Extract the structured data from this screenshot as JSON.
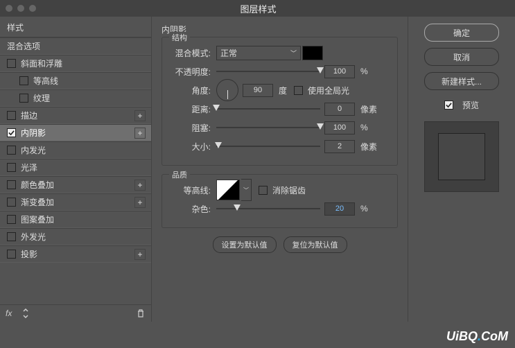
{
  "title": "图层样式",
  "sidebar": {
    "header": "样式",
    "blend": "混合选项",
    "items": [
      {
        "label": "斜面和浮雕"
      },
      {
        "label": "等高线",
        "sub": true
      },
      {
        "label": "纹理",
        "sub": true
      },
      {
        "label": "描边",
        "plus": true
      },
      {
        "label": "内阴影",
        "plus": true,
        "checked": true,
        "selected": true
      },
      {
        "label": "内发光"
      },
      {
        "label": "光泽"
      },
      {
        "label": "颜色叠加",
        "plus": true
      },
      {
        "label": "渐变叠加",
        "plus": true
      },
      {
        "label": "图案叠加"
      },
      {
        "label": "外发光"
      },
      {
        "label": "投影",
        "plus": true
      }
    ]
  },
  "main": {
    "title": "内阴影",
    "structure": {
      "legend": "结构",
      "blend_mode_label": "混合模式:",
      "blend_mode_value": "正常",
      "opacity_label": "不透明度:",
      "opacity_value": "100",
      "opacity_unit": "%",
      "angle_label": "角度:",
      "angle_value": "90",
      "angle_unit": "度",
      "global_light": "使用全局光",
      "distance_label": "距离:",
      "distance_value": "0",
      "distance_unit": "像素",
      "choke_label": "阻塞:",
      "choke_value": "100",
      "choke_unit": "%",
      "size_label": "大小:",
      "size_value": "2",
      "size_unit": "像素"
    },
    "quality": {
      "legend": "品质",
      "contour_label": "等高线:",
      "antialias": "消除锯齿",
      "noise_label": "杂色:",
      "noise_value": "20",
      "noise_unit": "%"
    },
    "set_default": "设置为默认值",
    "reset_default": "复位为默认值"
  },
  "right": {
    "ok": "确定",
    "cancel": "取消",
    "new_style": "新建样式...",
    "preview": "预览"
  },
  "watermark": "UiBQ.CoM"
}
